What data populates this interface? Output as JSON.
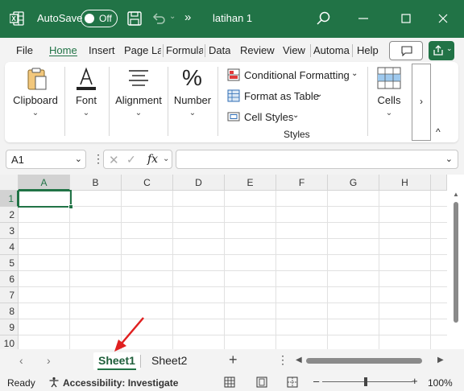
{
  "window": {
    "autosave_label": "AutoSave",
    "autosave_state": "Off",
    "doc_title": "latihan 1",
    "overflow_glyph": "»",
    "icons": [
      "excel-app-icon",
      "save-icon",
      "undo-icon",
      "search-icon",
      "minimize-icon",
      "maximize-icon",
      "close-icon"
    ],
    "accent_color": "#217346"
  },
  "ribbon": {
    "tabs": [
      {
        "label": "File"
      },
      {
        "label": "Home",
        "active": true
      },
      {
        "label": "Insert"
      },
      {
        "label": "Page La"
      },
      {
        "label": "Formula"
      },
      {
        "label": "Data"
      },
      {
        "label": "Review"
      },
      {
        "label": "View"
      },
      {
        "label": "Automa"
      },
      {
        "label": "Help"
      }
    ],
    "groups": {
      "clipboard": "Clipboard",
      "font": "Font",
      "alignment": "Alignment",
      "number": "Number",
      "cells": "Cells"
    },
    "styles": {
      "conditional_formatting": "Conditional Formatting",
      "format_as_table": "Format as Table",
      "cell_styles": "Cell Styles",
      "group_label": "Styles"
    },
    "more_glyph": "›",
    "collapse_glyph": "^"
  },
  "formula_bar": {
    "name_box": "A1",
    "fx_label": "fx",
    "formula": ""
  },
  "grid": {
    "columns": [
      "A",
      "B",
      "C",
      "D",
      "E",
      "F",
      "G",
      "H"
    ],
    "rows": [
      "1",
      "2",
      "3",
      "4",
      "5",
      "6",
      "7",
      "8",
      "9",
      "10"
    ],
    "active_cell": "A1"
  },
  "sheets": {
    "tabs": [
      {
        "label": "Sheet1",
        "active": true
      },
      {
        "label": "Sheet2"
      }
    ],
    "add_glyph": "+"
  },
  "status_bar": {
    "ready": "Ready",
    "accessibility": "Accessibility: Investigate",
    "zoom": "100%"
  },
  "annotation": {
    "arrow_color": "#e02020"
  }
}
